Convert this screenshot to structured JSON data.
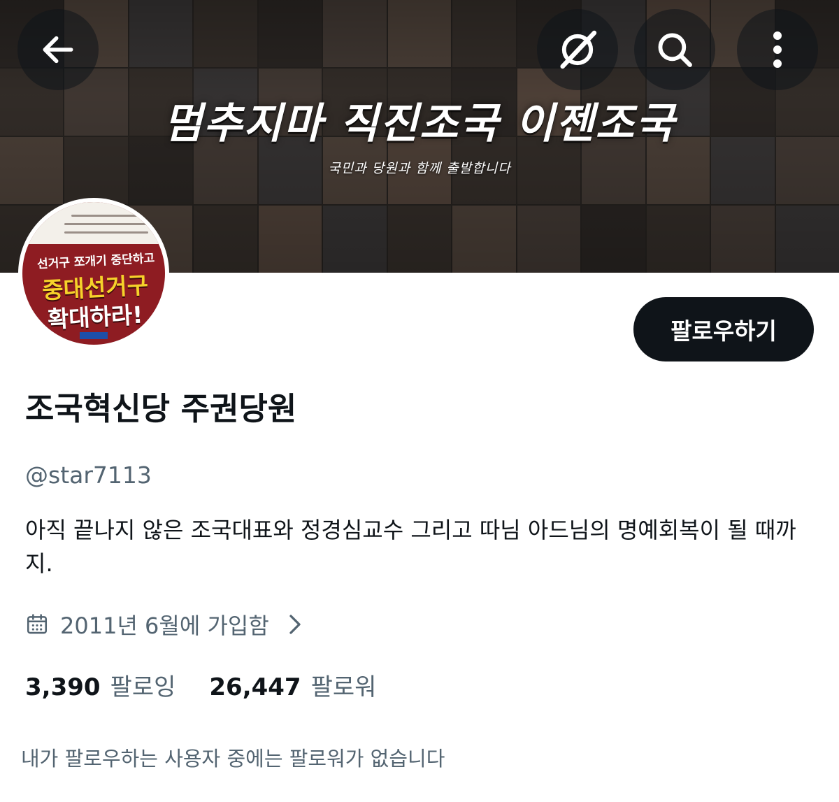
{
  "header": {
    "banner_title": "멈추지마 직진조국 이젠조국",
    "banner_subtitle": "국민과 당원과 함께 출발합니다"
  },
  "nav": {
    "back_icon": "arrow-left-icon",
    "grok_icon": "grok-slash-icon",
    "search_icon": "search-icon",
    "more_icon": "more-vertical-icon"
  },
  "avatar": {
    "line1": "선거구 쪼개기 중단하고",
    "line2": "중대선거구",
    "line3": "확대하라!"
  },
  "follow_button": {
    "label": "팔로우하기"
  },
  "profile": {
    "display_name": "조국혁신당 주권당원",
    "handle": "@star7113",
    "bio": "아직 끝나지 않은 조국대표와 정경심교수 그리고 따님 아드님의 명예회복이 될 때까지.",
    "joined": "2011년 6월에 가입함"
  },
  "stats": {
    "following_count": "3,390",
    "following_label": "팔로잉",
    "followers_count": "26,447",
    "followers_label": "팔로워"
  },
  "followed_by_text": "내가 팔로우하는 사용자 중에는 팔로워가 없습니다",
  "colors": {
    "text_primary": "#0f1419",
    "text_secondary": "#536471",
    "button_bg": "#0f1419",
    "avatar_red": "#8e1c22",
    "avatar_yellow": "#f6d22a"
  }
}
